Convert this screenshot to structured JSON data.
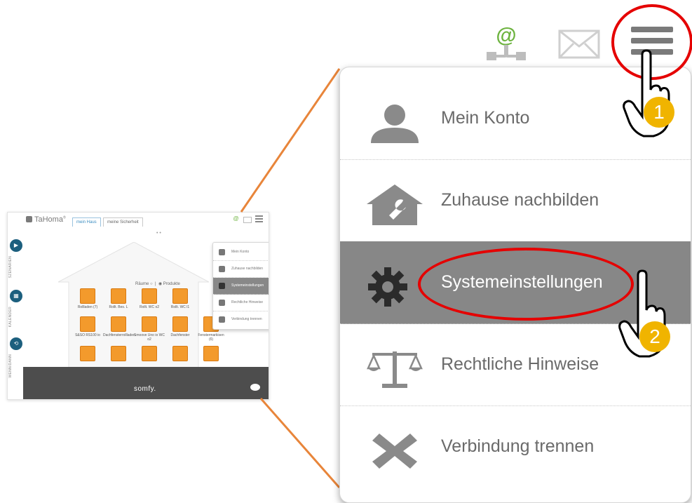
{
  "thumbnail": {
    "app_name": "TaHoma",
    "tabs": [
      {
        "label": "mein Haus",
        "active": true
      },
      {
        "label": "meine Sicherheit",
        "active": false
      }
    ],
    "side_labels": [
      "SZENARIEN",
      "KALENDER",
      "WENN/DANN"
    ],
    "pager": "• •",
    "view_toggle": {
      "rooms": "Räume",
      "products": "Produkte"
    },
    "devices": [
      "Rollladen (7)",
      "Rollt. Bes. L",
      "Rollt. WC o2",
      "Rollt. WC l1",
      "S&SO RS100 io",
      "Dachfensterrollladen",
      "Smoove Uno io WC o2",
      "Dachfenster",
      "Fenstermarkisen (6)",
      "",
      "",
      "",
      "",
      ""
    ],
    "brand": "somfy.",
    "menu_items": [
      "Mein Konto",
      "Zuhause nachbilden",
      "Systemeinstellungen",
      "Rechtliche Hinweise",
      "Verbindung trennen"
    ]
  },
  "zoom": {
    "header_icons": [
      "at-sign-icon",
      "envelope-icon",
      "hamburger-menu-icon"
    ],
    "menu_items": [
      {
        "label": "Mein Konto",
        "icon": "user-icon",
        "selected": false
      },
      {
        "label": "Zuhause nachbilden",
        "icon": "house-wrench-icon",
        "selected": false
      },
      {
        "label": "Systemeinstellungen",
        "icon": "gear-icon",
        "selected": true
      },
      {
        "label": "Rechtliche Hinweise",
        "icon": "scales-icon",
        "selected": false
      },
      {
        "label": "Verbindung trennen",
        "icon": "close-x-icon",
        "selected": false
      }
    ]
  },
  "annotations": {
    "step1": "1",
    "step2": "2",
    "highlight_color": "#e50000",
    "badge_color": "#f0b400"
  },
  "colors": {
    "accent": "#f39a2c",
    "selected_row": "#878787",
    "line_connector": "#e8853a"
  }
}
